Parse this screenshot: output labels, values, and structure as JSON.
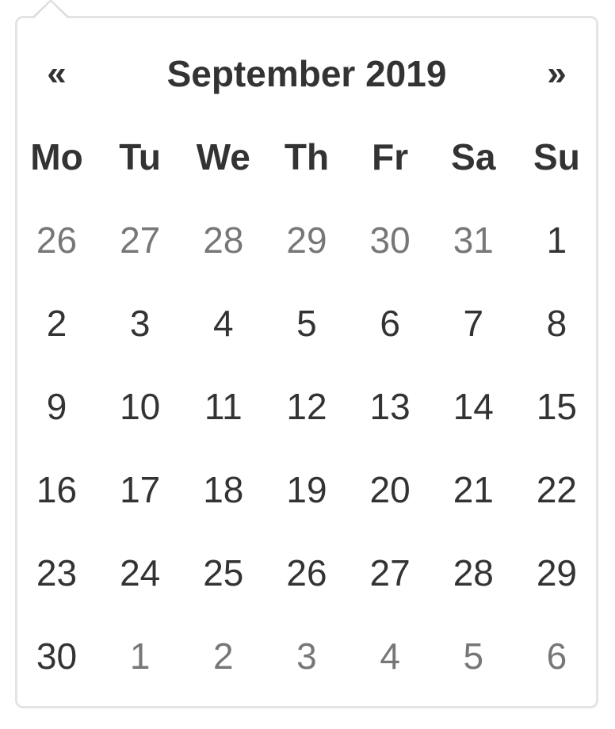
{
  "datepicker": {
    "prev_label": "«",
    "next_label": "»",
    "month_title": "September 2019",
    "weekdays": [
      "Mo",
      "Tu",
      "We",
      "Th",
      "Fr",
      "Sa",
      "Su"
    ],
    "weeks": [
      [
        {
          "d": "26",
          "m": "old"
        },
        {
          "d": "27",
          "m": "old"
        },
        {
          "d": "28",
          "m": "old"
        },
        {
          "d": "29",
          "m": "old"
        },
        {
          "d": "30",
          "m": "old"
        },
        {
          "d": "31",
          "m": "old"
        },
        {
          "d": "1",
          "m": "cur"
        }
      ],
      [
        {
          "d": "2",
          "m": "cur"
        },
        {
          "d": "3",
          "m": "cur"
        },
        {
          "d": "4",
          "m": "cur"
        },
        {
          "d": "5",
          "m": "cur"
        },
        {
          "d": "6",
          "m": "cur"
        },
        {
          "d": "7",
          "m": "cur"
        },
        {
          "d": "8",
          "m": "cur"
        }
      ],
      [
        {
          "d": "9",
          "m": "cur"
        },
        {
          "d": "10",
          "m": "cur"
        },
        {
          "d": "11",
          "m": "cur"
        },
        {
          "d": "12",
          "m": "cur"
        },
        {
          "d": "13",
          "m": "cur"
        },
        {
          "d": "14",
          "m": "cur"
        },
        {
          "d": "15",
          "m": "cur"
        }
      ],
      [
        {
          "d": "16",
          "m": "cur"
        },
        {
          "d": "17",
          "m": "cur"
        },
        {
          "d": "18",
          "m": "cur"
        },
        {
          "d": "19",
          "m": "cur"
        },
        {
          "d": "20",
          "m": "cur"
        },
        {
          "d": "21",
          "m": "cur"
        },
        {
          "d": "22",
          "m": "cur"
        }
      ],
      [
        {
          "d": "23",
          "m": "cur"
        },
        {
          "d": "24",
          "m": "cur"
        },
        {
          "d": "25",
          "m": "cur"
        },
        {
          "d": "26",
          "m": "cur"
        },
        {
          "d": "27",
          "m": "cur"
        },
        {
          "d": "28",
          "m": "cur"
        },
        {
          "d": "29",
          "m": "cur"
        }
      ],
      [
        {
          "d": "30",
          "m": "cur"
        },
        {
          "d": "1",
          "m": "new"
        },
        {
          "d": "2",
          "m": "new"
        },
        {
          "d": "3",
          "m": "new"
        },
        {
          "d": "4",
          "m": "new"
        },
        {
          "d": "5",
          "m": "new"
        },
        {
          "d": "6",
          "m": "new"
        }
      ]
    ]
  },
  "colors": {
    "text": "#333333",
    "muted": "#777777",
    "border": "#e4e4e4"
  }
}
